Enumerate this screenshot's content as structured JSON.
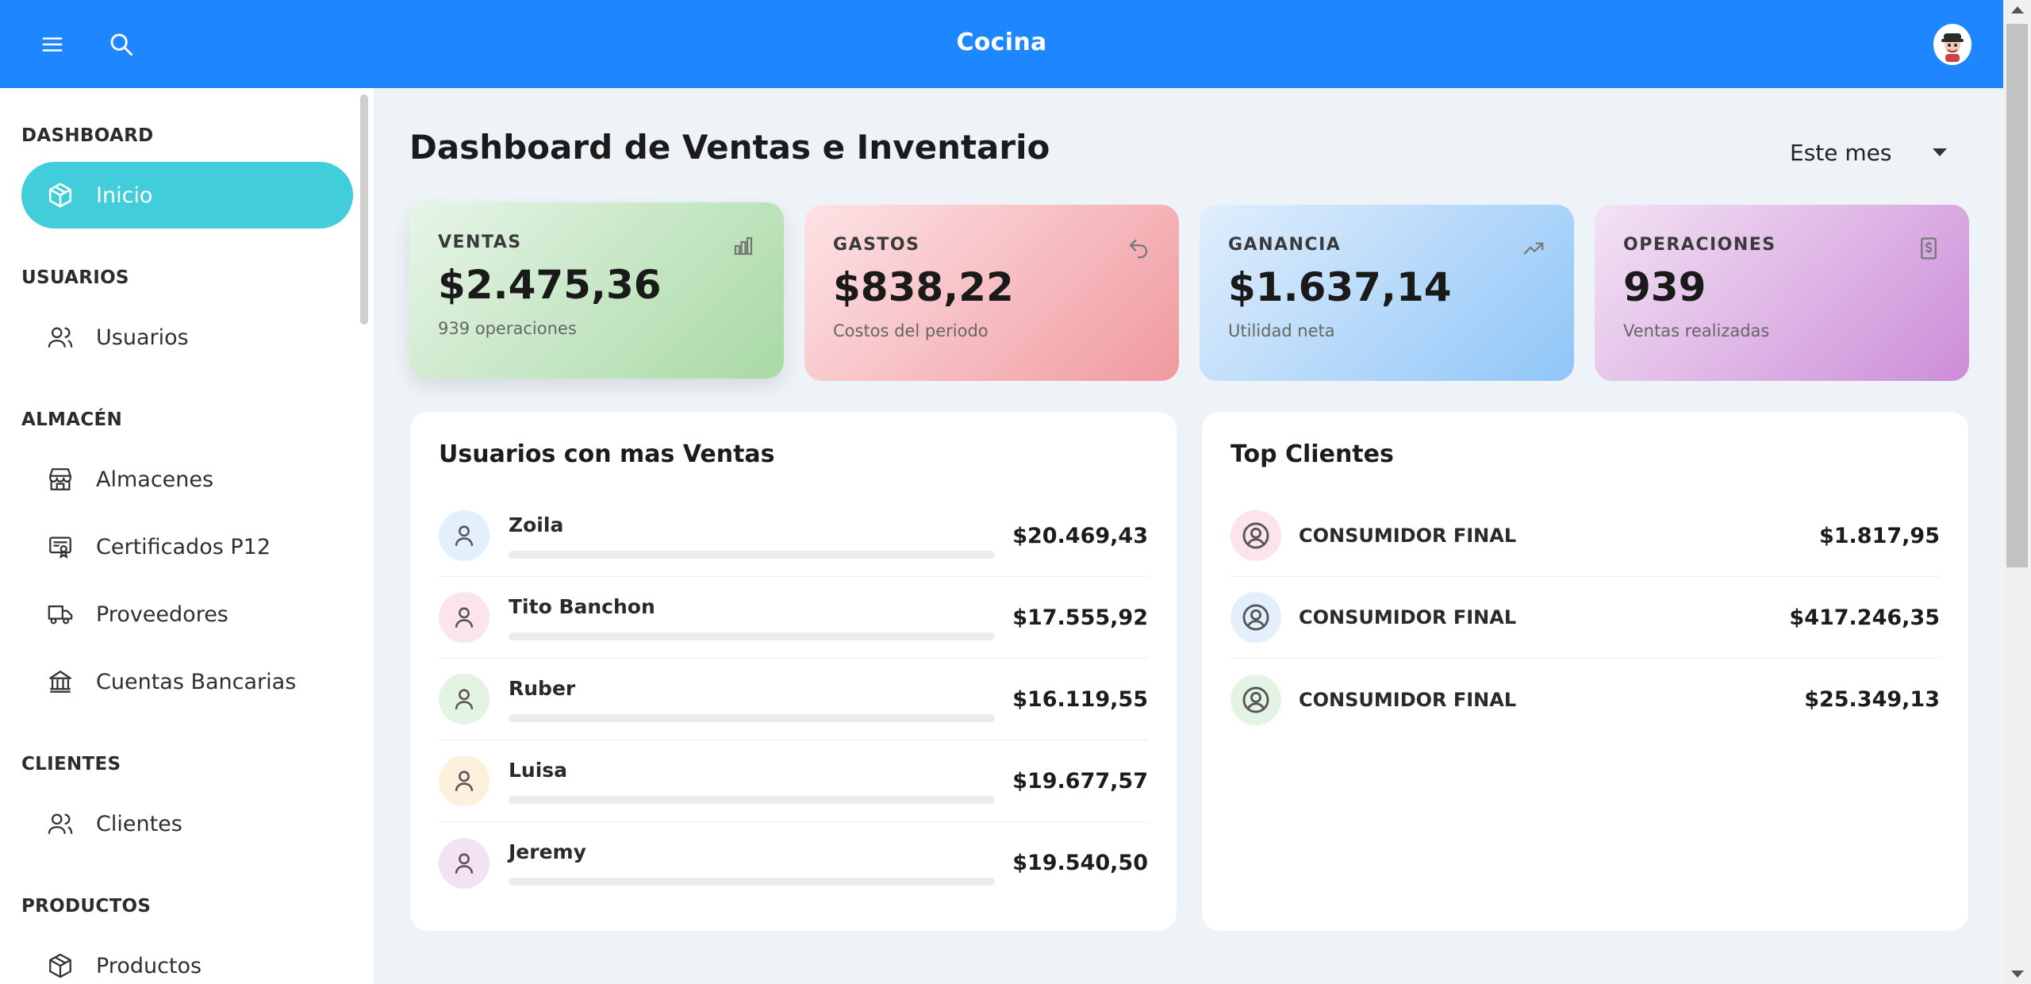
{
  "header": {
    "title": "Cocina",
    "bg_color": "#1e86ff",
    "icons": [
      "menu-icon",
      "search-icon",
      "user-avatar"
    ]
  },
  "sidebar": {
    "active_color": "#41cdd9",
    "sections": [
      {
        "heading": "DASHBOARD",
        "items": [
          {
            "label": "Inicio",
            "icon": "cube-icon",
            "active": true
          }
        ]
      },
      {
        "heading": "USUARIOS",
        "items": [
          {
            "label": "Usuarios",
            "icon": "users-icon"
          }
        ]
      },
      {
        "heading": "ALMACÉN",
        "items": [
          {
            "label": "Almacenes",
            "icon": "store-icon"
          },
          {
            "label": "Certificados P12",
            "icon": "certificate-icon"
          },
          {
            "label": "Proveedores",
            "icon": "truck-icon"
          },
          {
            "label": "Cuentas Bancarias",
            "icon": "bank-icon"
          }
        ]
      },
      {
        "heading": "CLIENTES",
        "items": [
          {
            "label": "Clientes",
            "icon": "users-icon"
          }
        ]
      },
      {
        "heading": "PRODUCTOS",
        "items": [
          {
            "label": "Productos",
            "icon": "cube-icon"
          }
        ]
      }
    ]
  },
  "main": {
    "title": "Dashboard de Ventas e Inventario",
    "period_select": "Este mes",
    "stats": [
      {
        "label": "VENTAS",
        "value": "$2.475,36",
        "sub": "939 operaciones",
        "icon": "bar-chart-icon"
      },
      {
        "label": "GASTOS",
        "value": "$838,22",
        "sub": "Costos del periodo",
        "icon": "undo-arrow-icon"
      },
      {
        "label": "GANANCIA",
        "value": "$1.637,14",
        "sub": "Utilidad neta",
        "icon": "trending-up-icon"
      },
      {
        "label": "OPERACIONES",
        "value": "939",
        "sub": "Ventas realizadas",
        "icon": "receipt-icon"
      }
    ],
    "top_users": {
      "title": "Usuarios con mas Ventas",
      "rows": [
        {
          "name": "Zoila",
          "amount": "$20.469,43",
          "avatar_bg": "#e3f0fc"
        },
        {
          "name": "Tito Banchon",
          "amount": "$17.555,92",
          "avatar_bg": "#fbe4ea"
        },
        {
          "name": "Ruber",
          "amount": "$16.119,55",
          "avatar_bg": "#e4f4e4"
        },
        {
          "name": "Luisa",
          "amount": "$19.677,57",
          "avatar_bg": "#fdf0dc"
        },
        {
          "name": "Jeremy",
          "amount": "$19.540,50",
          "avatar_bg": "#f2e2f4"
        }
      ]
    },
    "top_clients": {
      "title": "Top Clientes",
      "rows": [
        {
          "name": "CONSUMIDOR FINAL",
          "amount": "$1.817,95",
          "avatar_bg": "#fbe4ea"
        },
        {
          "name": "CONSUMIDOR FINAL",
          "amount": "$417.246,35",
          "avatar_bg": "#e3f0fc"
        },
        {
          "name": "CONSUMIDOR FINAL",
          "amount": "$25.349,13",
          "avatar_bg": "#e4f4e4"
        }
      ]
    }
  }
}
